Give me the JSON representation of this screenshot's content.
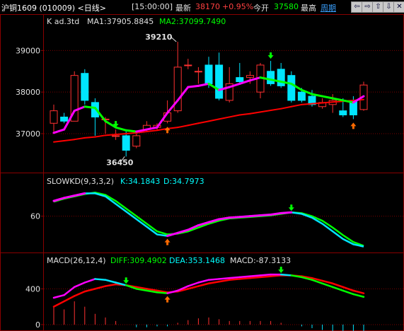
{
  "toolbar": {
    "instrument": "沪铜1609 (010009) <日线>",
    "time": "[15:00:00]",
    "latest_label": "最新",
    "latest_value": "38170",
    "change_pct": "+0.95%",
    "open_label": "今开",
    "open_value": "37580",
    "high_label": "最高",
    "period_label": "周期",
    "nav_icons": [
      "prev-arrow-icon",
      "next-arrow-icon",
      "up-arrow-icon",
      "down-arrow-icon",
      "close-icon"
    ],
    "nav_glyphs": [
      "⇦",
      "⇨",
      "⇧",
      "⇩",
      "✕"
    ]
  },
  "colors": {
    "up": "#ff3030",
    "down": "#00e5ff",
    "grid": "#7a0000",
    "ma1_text": "#e0e0e0",
    "ma2_text": "#00ff00",
    "ma2_line": "#ff0000",
    "ma1_up": "#ff00ff",
    "ma1_down": "#00ff00",
    "k_line": "#ff00ff",
    "d_line": "#00ff00"
  },
  "chart_data": [
    {
      "type": "candlestick",
      "panel": "price",
      "header": "K  ad.3td",
      "ma1_label": "MA1:37905.8845",
      "ma2_label": "MA2:37099.7490",
      "ylim": [
        36200,
        39500
      ],
      "y_ticks": [
        37000,
        38000,
        39000
      ],
      "annotations": [
        {
          "text": "39210",
          "candle": 12,
          "value": 39210
        },
        {
          "text": "36450",
          "candle": 7,
          "value": 36450
        }
      ],
      "candles": [
        {
          "open": 37250,
          "close": 37550,
          "high": 37700,
          "low": 37050
        },
        {
          "open": 37400,
          "close": 37300,
          "high": 37500,
          "low": 37250
        },
        {
          "open": 37300,
          "close": 38400,
          "high": 38500,
          "low": 37300
        },
        {
          "open": 38450,
          "close": 37800,
          "high": 38550,
          "low": 37700
        },
        {
          "open": 37750,
          "close": 37400,
          "high": 37850,
          "low": 36950
        },
        {
          "open": 37350,
          "close": 37350,
          "high": 37400,
          "low": 37000
        },
        {
          "open": 36950,
          "close": 36950,
          "high": 37100,
          "low": 36850
        },
        {
          "open": 36950,
          "close": 36600,
          "high": 37050,
          "low": 36450
        },
        {
          "open": 36700,
          "close": 36950,
          "high": 37050,
          "low": 36650
        },
        {
          "open": 37100,
          "close": 37200,
          "high": 37300,
          "low": 37050
        },
        {
          "open": 37150,
          "close": 37200,
          "high": 37250,
          "low": 37100
        },
        {
          "open": 37300,
          "close": 37500,
          "high": 37800,
          "low": 37250
        },
        {
          "open": 37550,
          "close": 38600,
          "high": 39210,
          "low": 37500
        },
        {
          "open": 38650,
          "close": 38650,
          "high": 38800,
          "low": 38550
        },
        {
          "open": 38500,
          "close": 38500,
          "high": 38600,
          "low": 38200
        },
        {
          "open": 38650,
          "close": 38200,
          "high": 38850,
          "low": 38100
        },
        {
          "open": 38650,
          "close": 37850,
          "high": 38950,
          "low": 37800
        },
        {
          "open": 37800,
          "close": 38200,
          "high": 38600,
          "low": 37750
        },
        {
          "open": 38350,
          "close": 38250,
          "high": 38700,
          "low": 38200
        },
        {
          "open": 38350,
          "close": 38400,
          "high": 38500,
          "low": 38200
        },
        {
          "open": 38000,
          "close": 38650,
          "high": 38700,
          "low": 37850
        },
        {
          "open": 38500,
          "close": 38200,
          "high": 38750,
          "low": 38150
        },
        {
          "open": 38550,
          "close": 38150,
          "high": 38700,
          "low": 38100
        },
        {
          "open": 38400,
          "close": 37800,
          "high": 38500,
          "low": 37750
        },
        {
          "open": 38000,
          "close": 37800,
          "high": 38100,
          "low": 37750
        },
        {
          "open": 37900,
          "close": 37700,
          "high": 38050,
          "low": 37650
        },
        {
          "open": 37650,
          "close": 37750,
          "high": 37850,
          "low": 37600
        },
        {
          "open": 37700,
          "close": 37800,
          "high": 37950,
          "low": 37500
        },
        {
          "open": 37550,
          "close": 37450,
          "high": 37850,
          "low": 37400
        },
        {
          "open": 37800,
          "close": 37450,
          "high": 37900,
          "low": 37350
        },
        {
          "open": 37580,
          "close": 38170,
          "high": 38250,
          "low": 37550
        }
      ],
      "ma1": [
        37020,
        37100,
        37550,
        37650,
        37620,
        37300,
        37150,
        37080,
        37050,
        37100,
        37150,
        37500,
        37800,
        38120,
        38150,
        38200,
        38050,
        38120,
        38200,
        38280,
        38350,
        38300,
        38250,
        38200,
        38050,
        37950,
        37900,
        37850,
        37800,
        37750,
        37900
      ],
      "ma2": [
        36800,
        36830,
        36860,
        36900,
        36920,
        36960,
        36980,
        37000,
        37020,
        37050,
        37080,
        37120,
        37150,
        37200,
        37250,
        37300,
        37350,
        37400,
        37450,
        37480,
        37520,
        37560,
        37600,
        37650,
        37700,
        37720,
        37740,
        37760,
        37780,
        37800,
        37820
      ],
      "signals": [
        {
          "candle": 11,
          "type": "buy"
        },
        {
          "candle": 29,
          "type": "buy"
        },
        {
          "candle": 21,
          "type": "sell"
        },
        {
          "candle": 6,
          "type": "sell"
        }
      ]
    },
    {
      "type": "line",
      "panel": "kd",
      "header": "SLOWKD(9,3,3,2)",
      "k_label": "K:34.1843",
      "d_label": "D:34.7973",
      "ylim": [
        15,
        95
      ],
      "y_ticks": [
        60
      ],
      "series": [
        {
          "name": "K",
          "values": [
            80,
            84,
            87,
            90,
            90,
            86,
            76,
            66,
            56,
            46,
            36,
            34,
            38,
            42,
            48,
            52,
            56,
            58,
            59,
            60,
            61,
            62,
            64,
            65,
            63,
            58,
            50,
            40,
            30,
            23,
            20
          ]
        },
        {
          "name": "D",
          "values": [
            79,
            83,
            86,
            89,
            91,
            88,
            80,
            70,
            60,
            50,
            40,
            36,
            37,
            40,
            45,
            50,
            54,
            57,
            58,
            59,
            60,
            61,
            63,
            65,
            64,
            60,
            54,
            45,
            35,
            26,
            21
          ]
        }
      ],
      "signals": [
        {
          "index": 11,
          "type": "buy"
        },
        {
          "index": 23,
          "type": "sell"
        }
      ]
    },
    {
      "type": "line",
      "panel": "macd",
      "header": "MACD(26,12,4)",
      "diff_label": "DIFF:309.4902",
      "dea_label": "DEA:353.1468",
      "macd_label": "MACD:-87.3133",
      "ylim": [
        -40,
        640
      ],
      "y_ticks": [
        0,
        400
      ],
      "series": [
        {
          "name": "DIFF",
          "values": [
            300,
            330,
            420,
            470,
            510,
            500,
            470,
            440,
            400,
            380,
            360,
            350,
            380,
            430,
            470,
            500,
            510,
            520,
            530,
            540,
            550,
            560,
            560,
            550,
            530,
            500,
            460,
            420,
            380,
            340,
            310
          ]
        },
        {
          "name": "DEA",
          "values": [
            200,
            260,
            320,
            370,
            400,
            430,
            450,
            440,
            420,
            400,
            380,
            360,
            370,
            400,
            430,
            460,
            480,
            500,
            510,
            520,
            530,
            540,
            550,
            550,
            540,
            520,
            490,
            460,
            420,
            380,
            350
          ]
        },
        {
          "name": "MACD",
          "values": [
            200,
            170,
            260,
            200,
            120,
            80,
            40,
            0,
            -30,
            -30,
            -20,
            -20,
            20,
            50,
            70,
            80,
            60,
            40,
            40,
            40,
            40,
            40,
            20,
            0,
            -20,
            -40,
            -60,
            -80,
            -80,
            -80,
            -87
          ]
        }
      ],
      "signals": [
        {
          "index": 11,
          "type": "buy"
        },
        {
          "index": 7,
          "type": "sell"
        },
        {
          "index": 22,
          "type": "sell"
        }
      ]
    }
  ]
}
